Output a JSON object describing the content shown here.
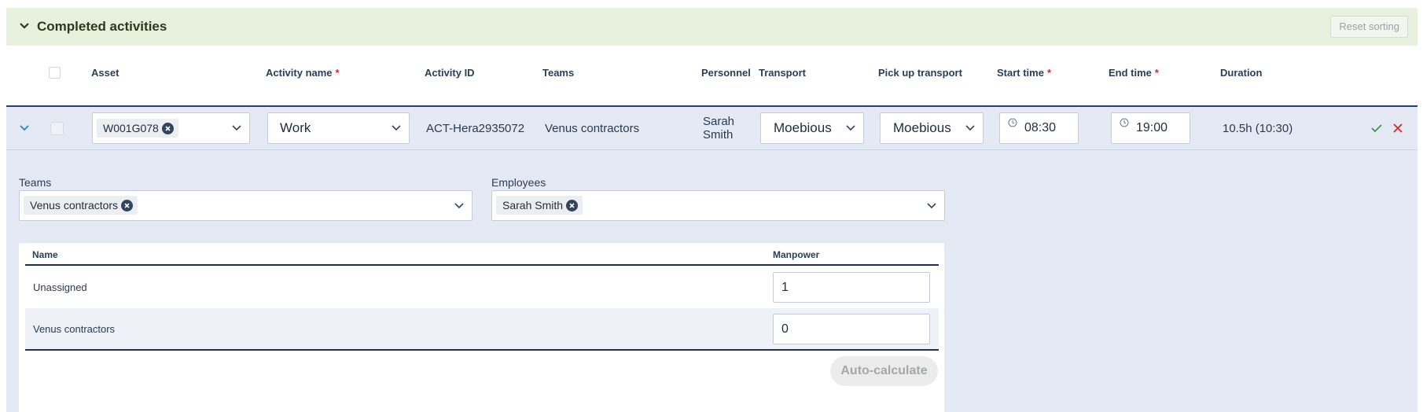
{
  "panel": {
    "title": "Completed activities",
    "reset_sorting_label": "Reset sorting"
  },
  "columns": {
    "asset": "Asset",
    "activity_name": "Activity name",
    "activity_id": "Activity ID",
    "teams": "Teams",
    "personnel": "Personnel",
    "transport": "Transport",
    "pickup_transport": "Pick up transport",
    "start_time": "Start time",
    "end_time": "End time",
    "duration": "Duration",
    "required_marker": "*"
  },
  "row": {
    "asset_chip": "W001G078",
    "activity_name": "Work",
    "activity_id": "ACT-Hera2935072",
    "teams": "Venus contractors",
    "personnel_line1": "Sarah",
    "personnel_line2": "Smith",
    "transport": "Moebious",
    "pickup_transport": "Moebious",
    "start_time": "08:30",
    "end_time": "19:00",
    "duration": "10.5h (10:30)"
  },
  "details": {
    "teams_label": "Teams",
    "teams_chip": "Venus contractors",
    "employees_label": "Employees",
    "employees_chip": "Sarah Smith"
  },
  "manpower_table": {
    "headers": {
      "name": "Name",
      "manpower": "Manpower"
    },
    "rows": [
      {
        "name": "Unassigned",
        "manpower": "1"
      },
      {
        "name": "Venus contractors",
        "manpower": "0"
      }
    ],
    "auto_calculate_label": "Auto-calculate"
  },
  "colors": {
    "header_bg": "#e8f1dd",
    "expanded_bg": "#e4e9f3",
    "accent_navy": "#27406e",
    "confirm_green": "#3a9a4a",
    "cancel_red": "#d9272e",
    "required_red": "#d9272e"
  },
  "icons": [
    "chevron-down-icon",
    "remove-chip-icon",
    "clock-icon",
    "check-icon",
    "close-icon"
  ]
}
